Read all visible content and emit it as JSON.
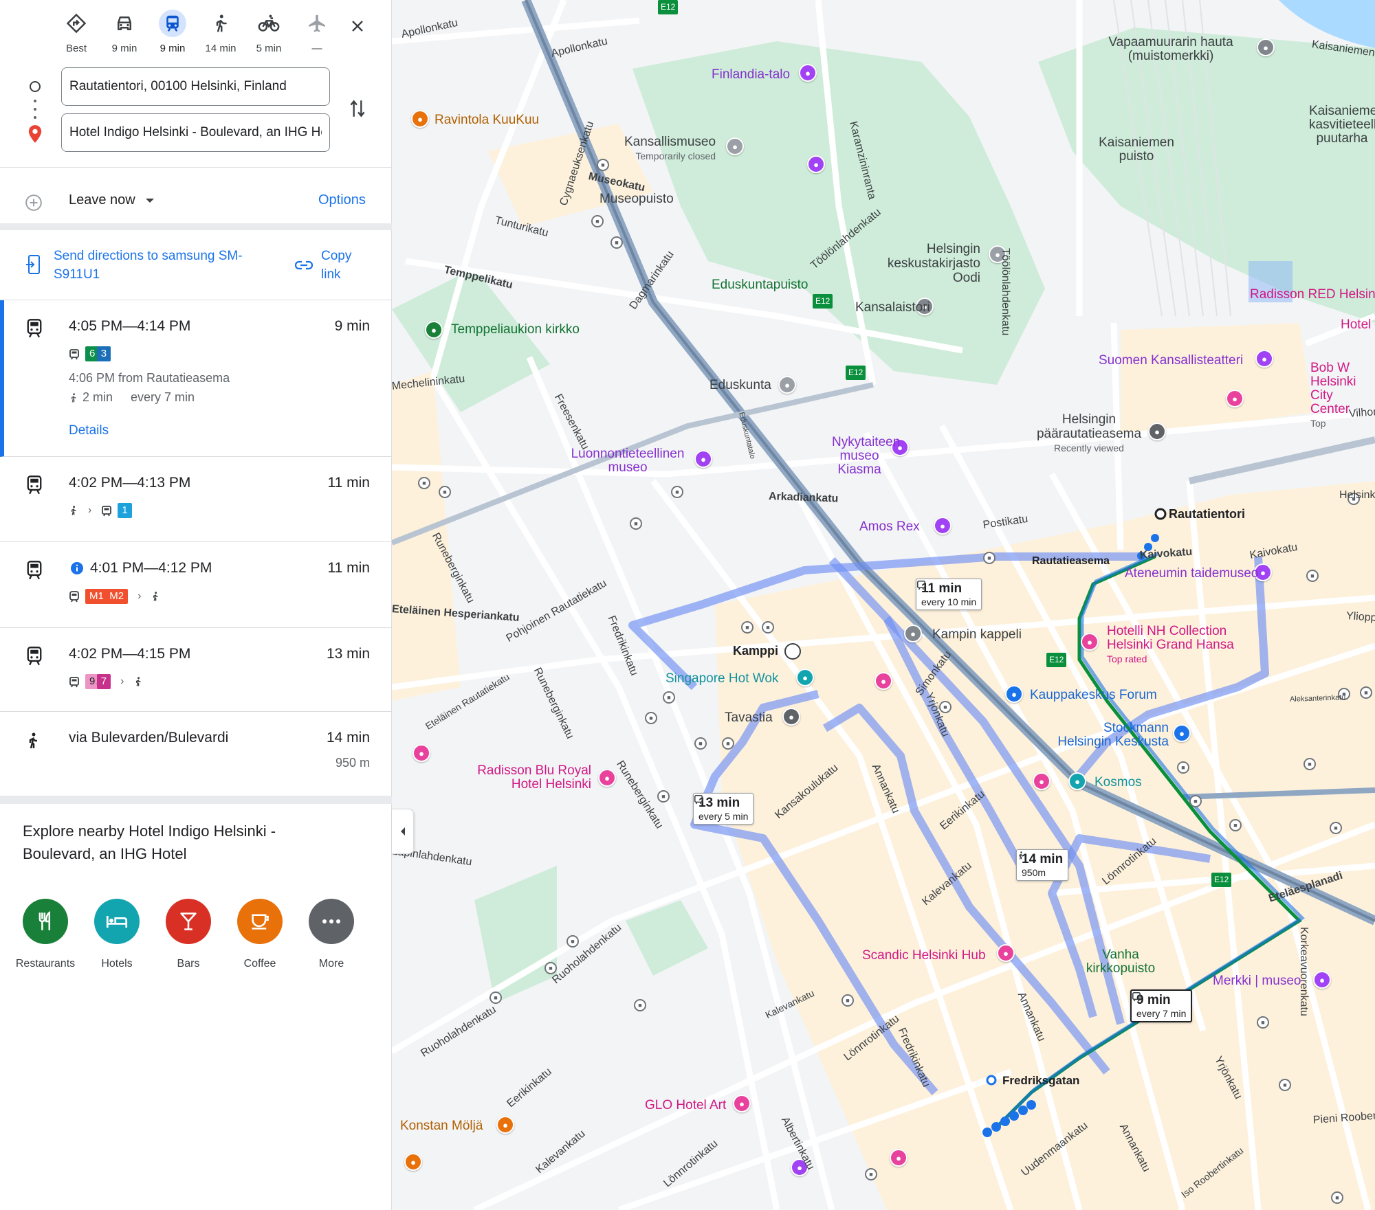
{
  "modes": [
    {
      "name": "best",
      "label": "Best",
      "icon": "diamond-turn-icon"
    },
    {
      "name": "drive",
      "label": "9 min",
      "icon": "car-icon"
    },
    {
      "name": "transit",
      "label": "9 min",
      "icon": "train-icon",
      "active": true
    },
    {
      "name": "walk",
      "label": "14 min",
      "icon": "walk-icon"
    },
    {
      "name": "bike",
      "label": "5 min",
      "icon": "bike-icon"
    },
    {
      "name": "flight",
      "label": "—",
      "icon": "plane-icon"
    }
  ],
  "origin": {
    "value": "Rautatientori, 00100 Helsinki, Finland"
  },
  "destination": {
    "value": "Hotel Indigo Helsinki - Boulevard, an IHG Hotel"
  },
  "leave": {
    "label": "Leave now"
  },
  "options_label": "Options",
  "send": {
    "label": "Send directions to samsung SM-S911U1",
    "copy_label": "Copy link"
  },
  "routes": [
    {
      "time": "4:05 PM—4:14 PM",
      "duration": "9 min",
      "lines": [
        "6",
        "3"
      ],
      "from": "4:06 PM from Rautatieasema",
      "walk": "2 min",
      "freq": "every 7 min",
      "details": "Details"
    },
    {
      "time": "4:02 PM—4:13 PM",
      "duration": "11 min",
      "lines": [
        "1"
      ]
    },
    {
      "time": "4:01 PM—4:12 PM",
      "duration": "11 min",
      "lines": [
        "M1",
        "M2"
      ]
    },
    {
      "time": "4:02 PM—4:15 PM",
      "duration": "13 min",
      "lines": [
        "9",
        "7"
      ]
    },
    {
      "time": "via Bulevarden/Bulevardi",
      "duration": "14 min",
      "distance": "950 m"
    }
  ],
  "explore": {
    "title": "Explore nearby Hotel Indigo Helsinki - Boulevard, an IHG Hotel",
    "categories": [
      {
        "label": "Restaurants",
        "color": "#188038",
        "icon": "fork-knife-icon"
      },
      {
        "label": "Hotels",
        "color": "#12a4af",
        "icon": "bed-icon"
      },
      {
        "label": "Bars",
        "color": "#d93025",
        "icon": "cocktail-icon"
      },
      {
        "label": "Coffee",
        "color": "#e8710a",
        "icon": "coffee-icon"
      },
      {
        "label": "More",
        "color": "#5f6368",
        "icon": "more-dots-icon"
      }
    ]
  },
  "map": {
    "pois": [
      {
        "label": "Ravintola KuuKuu"
      },
      {
        "label": "Finlandia-talo"
      },
      {
        "label": "Kansallismuseo",
        "sub": "Temporarily closed"
      },
      {
        "label": "Museopuisto"
      },
      {
        "label": "Temppeliaukion kirkko"
      },
      {
        "label": "Eduskuntapuisto"
      },
      {
        "label": "Kansalaistori"
      },
      {
        "label": "Helsingin keskustakirjasto Oodi"
      },
      {
        "label": "Eduskunta"
      },
      {
        "label": "Luonnontieteellinen museo"
      },
      {
        "label": "Nykytaiteen museo Kiasma"
      },
      {
        "label": "Vapaamuurarin hauta (muistomerkki)"
      },
      {
        "label": "Kaisaniemen puisto"
      },
      {
        "label": "Kaisaniemen kasvitieteellinen puutarha"
      },
      {
        "label": "Radisson RED Helsinki"
      },
      {
        "label": "Hotel"
      },
      {
        "label": "Suomen Kansallisteatteri"
      },
      {
        "label": "Bob W Helsinki City Center",
        "sub": "Top"
      },
      {
        "label": "Helsingin päärautatieasema",
        "sub": "Recently viewed"
      },
      {
        "label": "Rautatientori"
      },
      {
        "label": "Rautatieasema"
      },
      {
        "label": "Amos Rex"
      },
      {
        "label": "Ateneumin taidemuseo"
      },
      {
        "label": "Kampin kappeli"
      },
      {
        "label": "Hotelli NH Collection Helsinki Grand Hansa",
        "sub": "Top rated"
      },
      {
        "label": "Kamppi"
      },
      {
        "label": "Singapore Hot Wok"
      },
      {
        "label": "Kauppakeskus Forum"
      },
      {
        "label": "Tavastia"
      },
      {
        "label": "Stockmann Helsingin Keskusta"
      },
      {
        "label": "Kosmos"
      },
      {
        "label": "Radisson Blu Royal Hotel Helsinki"
      },
      {
        "label": "Scandic Helsinki Hub"
      },
      {
        "label": "Vanha kirkkopuisto"
      },
      {
        "label": "Merkki | museo"
      },
      {
        "label": "Fredriksgatan"
      },
      {
        "label": "GLO Hotel Art"
      },
      {
        "label": "Konstan Möljä"
      }
    ],
    "streets": [
      "Apollonkatu",
      "Apollonkatu",
      "Cygnaeuksenkatu",
      "Museokatu",
      "Tunturikatu",
      "Temppelikatu",
      "Dagmarinkatu",
      "Karamzininranta",
      "Töölönlahdenkatu",
      "Töölönlahdenkatu",
      "Freesenkatu",
      "Eduskuntatalo",
      "Arkadiankatu",
      "Postikatu",
      "Kaivokatu",
      "Kaivokatu",
      "Runeberginkatu",
      "Pohjoinen Rautatiekatu",
      "Fredrikinkatu",
      "Eteläinen Rautatiekatu",
      "Runeberginkatu",
      "Runeberginkatu",
      "Simonkatu",
      "Yrjönkatu",
      "Annankatu",
      "Kansakoulukatu",
      "Eerikinkatu",
      "Kalevankatu",
      "Lönnrotinkatu",
      "Eteläesplanadi",
      "Korkeavuorenkatu",
      "Ruoholahdenkatu",
      "Ruoholahdenkatu",
      "Kalevankatu",
      "Lönnrotinkatu",
      "Fredrikinkatu",
      "Annankatu",
      "Eerikinkatu",
      "Kalevankatu",
      "Lönnrotinkatu",
      "Albertinkatu",
      "Uudenmaankatu",
      "Annankatu",
      "Iso Roobertinkatu",
      "Yrjönkatu",
      "Pieni Roobertinkatu",
      "Aleksanterinkatu",
      "Ylioppilastalo",
      "Vilhonkatu",
      "Helsinki",
      "Kaisaniemenkatu",
      "Mechelininkatu",
      "Eteläinen Hesperiankatu",
      "Lapinlahdenkatu"
    ],
    "tips": [
      {
        "time": "11 min",
        "sub": "every 10 min"
      },
      {
        "time": "13 min",
        "sub": "every 5 min"
      },
      {
        "time": "14 min",
        "sub": "950m"
      },
      {
        "time": "9 min",
        "sub": "every 7 min"
      }
    ],
    "road_shields": [
      "E12",
      "E12",
      "E12",
      "E12",
      "E12"
    ]
  }
}
